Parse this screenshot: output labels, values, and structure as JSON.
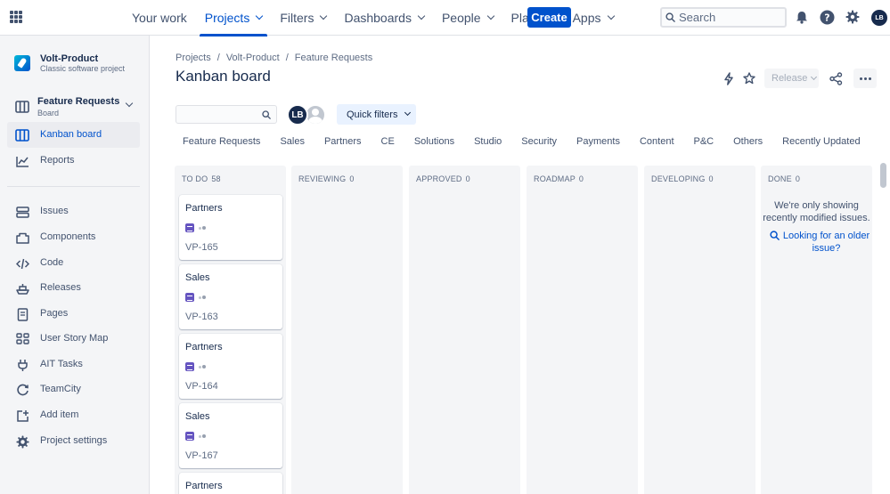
{
  "topnav": {
    "items": [
      {
        "label": "Your work",
        "dropdown": false,
        "active": false
      },
      {
        "label": "Projects",
        "dropdown": true,
        "active": true
      },
      {
        "label": "Filters",
        "dropdown": true,
        "active": false
      },
      {
        "label": "Dashboards",
        "dropdown": true,
        "active": false
      },
      {
        "label": "People",
        "dropdown": true,
        "active": false
      },
      {
        "label": "Plans",
        "dropdown": true,
        "active": false
      },
      {
        "label": "Apps",
        "dropdown": true,
        "active": false
      }
    ],
    "create_label": "Create",
    "search_placeholder": "Search",
    "avatar_initials": "LB",
    "accent_color": "#0052cc"
  },
  "sidebar": {
    "project_name": "Volt-Product",
    "project_type": "Classic software project",
    "board_name": "Feature Requests",
    "board_sub": "Board",
    "primary_items": [
      {
        "label": "Kanban board",
        "icon": "board-icon",
        "selected": true
      },
      {
        "label": "Reports",
        "icon": "chart-icon",
        "selected": false
      }
    ],
    "secondary_items": [
      {
        "label": "Issues",
        "icon": "issues-icon"
      },
      {
        "label": "Components",
        "icon": "component-icon"
      },
      {
        "label": "Code",
        "icon": "code-icon"
      },
      {
        "label": "Releases",
        "icon": "ship-icon"
      },
      {
        "label": "Pages",
        "icon": "page-icon"
      },
      {
        "label": "User Story Map",
        "icon": "storymap-icon"
      },
      {
        "label": "AIT Tasks",
        "icon": "plug-icon"
      },
      {
        "label": "TeamCity",
        "icon": "teamcity-icon"
      },
      {
        "label": "Add item",
        "icon": "add-item-icon"
      },
      {
        "label": "Project settings",
        "icon": "gear-icon"
      }
    ]
  },
  "main": {
    "breadcrumbs": [
      "Projects",
      "Volt-Product",
      "Feature Requests"
    ],
    "title": "Kanban board",
    "release_label": "Release",
    "avatar_initials": "LB",
    "quick_filters_label": "Quick filters",
    "filters": [
      "Feature Requests",
      "Sales",
      "Partners",
      "CE",
      "Solutions",
      "Studio",
      "Security",
      "Payments",
      "Content",
      "P&C",
      "Others",
      "Recently Updated"
    ]
  },
  "board": {
    "columns": [
      {
        "name": "TO DO",
        "count": "58"
      },
      {
        "name": "REVIEWING",
        "count": "0"
      },
      {
        "name": "APPROVED",
        "count": "0"
      },
      {
        "name": "ROADMAP",
        "count": "0"
      },
      {
        "name": "DEVELOPING",
        "count": "0"
      },
      {
        "name": "DONE",
        "count": "0"
      }
    ],
    "cards": [
      {
        "title": "Partners",
        "key": "VP-165"
      },
      {
        "title": "Sales",
        "key": "VP-163"
      },
      {
        "title": "Partners",
        "key": "VP-164"
      },
      {
        "title": "Sales",
        "key": "VP-167"
      },
      {
        "title": "Partners",
        "key": ""
      }
    ],
    "issue_type_color": "#6554c0",
    "done_message": "We're only showing recently modified issues.",
    "done_link": "Looking for an older issue?"
  }
}
